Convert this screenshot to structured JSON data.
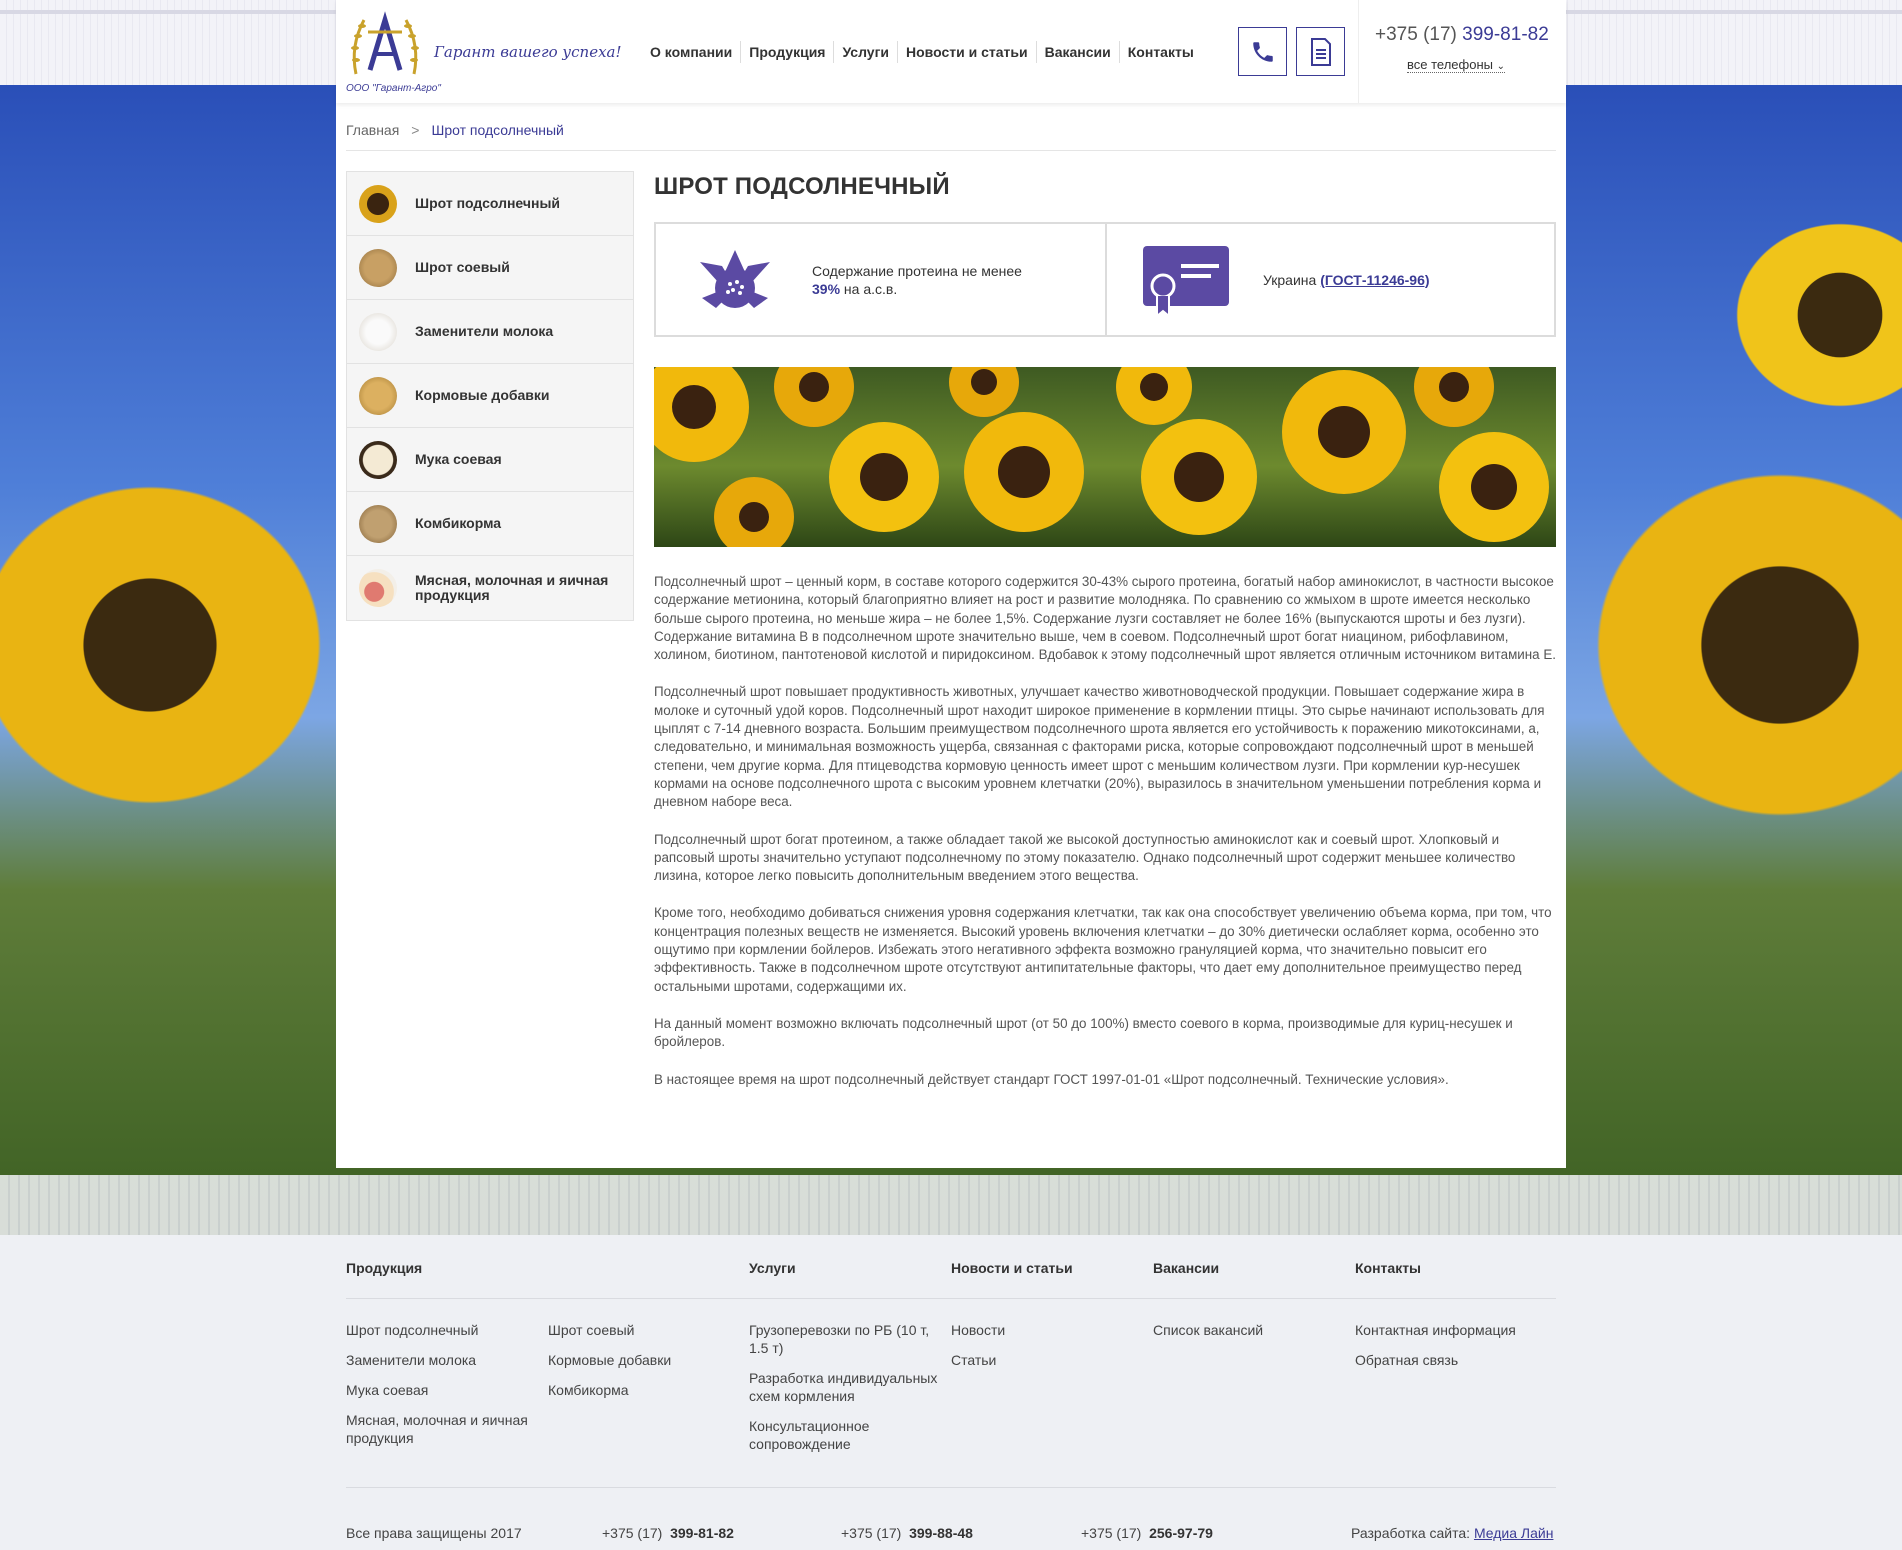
{
  "header": {
    "logo_slogan": "Гарант вашего успеха!",
    "logo_company": "ООО \"Гарант-Агро\"",
    "nav": [
      "О компании",
      "Продукция",
      "Услуги",
      "Новости и статьи",
      "Вакансии",
      "Контакты"
    ],
    "phone_code": "+375 (17)",
    "phone_number": "399-81-82",
    "all_phones": "все телефоны"
  },
  "breadcrumb": {
    "home": "Главная",
    "separator": ">",
    "current": "Шрот подсолнечный"
  },
  "sidebar": {
    "items": [
      {
        "label": "Шрот подсолнечный",
        "color": "#d9a21a"
      },
      {
        "label": "Шрот соевый",
        "color": "#b48a4f"
      },
      {
        "label": "Заменители молока",
        "color": "#e9e4dc"
      },
      {
        "label": "Кормовые добавки",
        "color": "#c59a4a"
      },
      {
        "label": "Мука соевая",
        "color": "#efe3c8"
      },
      {
        "label": "Комбикорма",
        "color": "#a9885a"
      },
      {
        "label": "Мясная, молочная и яичная продукция",
        "color": "#f0c0a8"
      }
    ]
  },
  "main": {
    "title": "ШРОТ ПОДСОЛНЕЧНЫЙ",
    "feature1": {
      "text_line1": "Содержание протеина не менее",
      "value": "39%",
      "text_line2": "на а.с.в."
    },
    "feature2": {
      "country": "Украина",
      "link": "(ГОСТ-11246-96)"
    },
    "paragraphs": [
      "Подсолнечный шрот – ценный корм, в составе которого содержится 30-43% сырого протеина, богатый набор аминокислот, в частности высокое содержание метионина, который благоприятно влияет на рост и развитие молодняка. По сравнению со жмыхом в шроте имеется несколько больше сырого протеина, но меньше жира – не более 1,5%. Содержание лузги составляет не более 16% (выпускаются шроты и без лузги). Содержание витамина В в подсолнечном шроте значительно выше, чем в соевом. Подсолнечный шрот богат ниацином, рибофлавином, холином, биотином, пантотеновой кислотой и пиридоксином. Вдобавок к этому подсолнечный шрот является отличным источником витамина Е.",
      "Подсолнечный шрот повышает продуктивность животных, улучшает качество животноводческой продукции. Повышает содержание жира в молоке и суточный удой коров. Подсолнечный шрот находит широкое применение в кормлении птицы. Это сырье начинают использовать для цыплят с 7-14 дневного возраста. Большим преимуществом подсолнечного шрота является его устойчивость к поражению микотоксинами, а, следовательно, и минимальная возможность ущерба, связанная с факторами риска, которые сопровождают подсолнечный шрот в меньшей степени, чем другие корма. Для птицеводства кормовую ценность имеет шрот с меньшим количеством лузги. При кормлении кур-несушек кормами на основе подсолнечного шрота с высоким уровнем клетчатки (20%), выразилось в значительном уменьшении потребления корма и дневном наборе веса.",
      "Подсолнечный шрот богат протеином, а также обладает такой же высокой доступностью аминокислот как и соевый шрот. Хлопковый и рапсовый шроты значительно уступают подсолнечному по этому показателю. Однако подсолнечный шрот содержит меньшее количество лизина, которое легко повысить дополнительным введением этого вещества.",
      "Кроме того, необходимо добиваться снижения уровня содержания клетчатки, так как она способствует увеличению объема корма, при том, что концентрация полезных веществ не изменяется. Высокий уровень включения клетчатки – до 30% диетически ослабляет корма, особенно это ощутимо при кормлении бойлеров. Избежать этого негативного эффекта возможно грануляцией корма, что значительно повысит его эффективность. Также в подсолнечном шроте отсутствуют антипитательные факторы, что дает ему дополнительное преимущество перед остальными шротами, содержащими их.",
      "На данный момент возможно включать подсолнечный шрот (от 50 до 100%) вместо соевого в корма, производимые для куриц-несушек и бройлеров.",
      "В настоящее время на шрот подсолнечный действует стандарт ГОСТ 1997-01-01 «Шрот подсолнечный. Технические условия»."
    ]
  },
  "footer": {
    "headings": [
      "Продукция",
      "Услуги",
      "Новости и статьи",
      "Вакансии",
      "Контакты"
    ],
    "products_col1": [
      "Шрот подсолнечный",
      "Заменители молока",
      "Мука соевая",
      "Мясная, молочная и яичная продукция"
    ],
    "products_col2": [
      "Шрот соевый",
      "Кормовые добавки",
      "Комбикорма"
    ],
    "services": [
      "Грузоперевозки по РБ (10 т, 1.5 т)",
      "Разработка индивидуальных схем кормления",
      "Консультационное сопровождение"
    ],
    "news": [
      "Новости",
      "Статьи"
    ],
    "vacancies": [
      "Список вакансий"
    ],
    "contacts": [
      "Контактная информация",
      "Обратная связь"
    ],
    "copyright": "Все права защищены 2017",
    "phones": [
      {
        "code": "+375 (17)",
        "number": "399-81-82"
      },
      {
        "code": "+375 (17)",
        "number": "399-88-48"
      },
      {
        "code": "+375 (17)",
        "number": "256-97-79"
      }
    ],
    "dev_label": "Разработка сайта:",
    "dev_link": "Медиа Лайн"
  },
  "colors": {
    "accent": "#3b3b95",
    "sunflower": "#e9b412"
  }
}
